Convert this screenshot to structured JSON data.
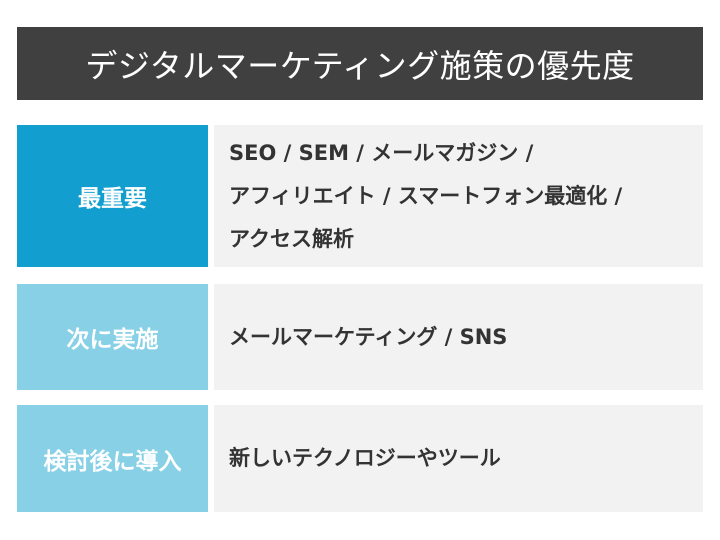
{
  "title": "デジタルマーケティング施策の優先度",
  "rows": [
    {
      "label": "最重要",
      "color": "#129fcf",
      "lines": [
        "SEO / SEM / メールマガジン /",
        "アフィリエイト / スマートフォン最適化 /",
        "アクセス解析"
      ]
    },
    {
      "label": "次に実施",
      "color": "#87d0e6",
      "lines": [
        "メールマーケティング / SNS"
      ]
    },
    {
      "label": "検討後に導入",
      "color": "#87d0e6",
      "lines": [
        "新しいテクノロジーやツール"
      ]
    }
  ]
}
